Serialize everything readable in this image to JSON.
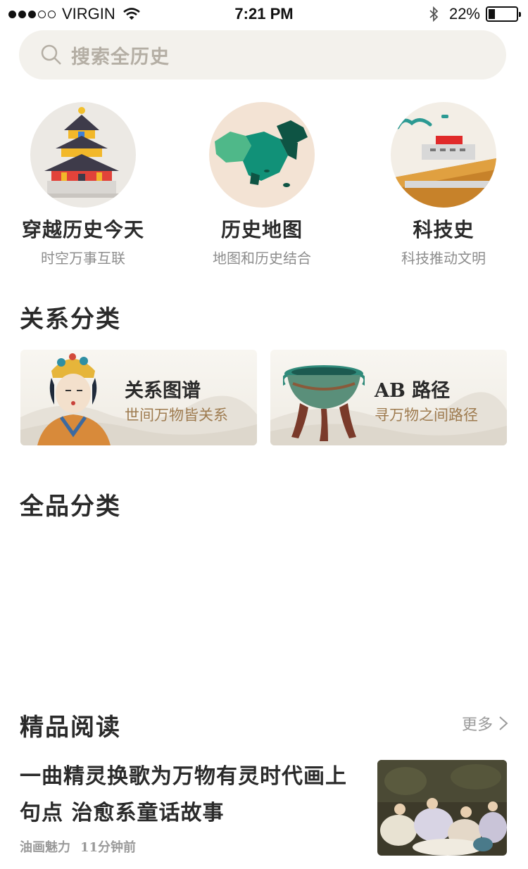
{
  "status_bar": {
    "carrier": "VIRGIN",
    "time": "7:21 PM",
    "battery": "22%",
    "battery_level": 0.22,
    "signal_bars": 3
  },
  "search": {
    "placeholder": "搜索全历史"
  },
  "features": [
    {
      "title": "穿越历史今天",
      "subtitle": "时空万事互联",
      "icon": "temple-of-heaven-icon"
    },
    {
      "title": "历史地图",
      "subtitle": "地图和历史结合",
      "icon": "china-map-icon"
    },
    {
      "title": "科技史",
      "subtitle": "科技推动文明",
      "icon": "great-wall-icon"
    }
  ],
  "sections": {
    "relations": "关系分类",
    "categories": "全品分类",
    "reading": "精品阅读"
  },
  "relation_cards": [
    {
      "title": "关系图谱",
      "subtitle": "世间万物皆关系",
      "icon": "empress-portrait-icon"
    },
    {
      "title": "AB 路径",
      "subtitle": "寻万物之间路径",
      "icon": "bronze-cauldron-icon"
    }
  ],
  "reading": {
    "more_label": "更多",
    "article": {
      "title": "一曲精灵换歌为万物有灵时代画上句点 治愈系童话故事",
      "source": "油画魅力",
      "time": "11分钟前",
      "thumbnail_icon": "oil-painting-thumbnail"
    }
  },
  "colors": {
    "search_bg": "#f3f1ec",
    "highlight": "#fbeedd",
    "card_subtitle": "#9e7b4f",
    "muted_text": "#8d8d8d"
  }
}
